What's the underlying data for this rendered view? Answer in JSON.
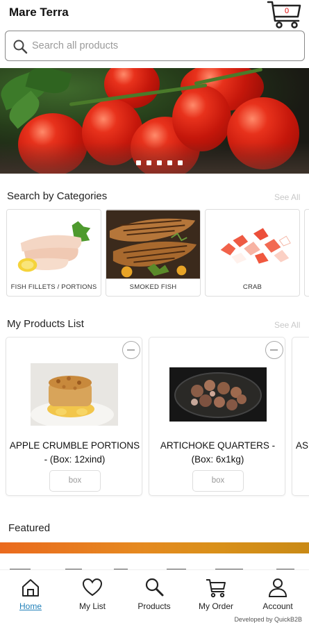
{
  "header": {
    "title": "Mare Terra",
    "cart_count": "0"
  },
  "search": {
    "placeholder": "Search all products"
  },
  "banner": {
    "slides": 5
  },
  "categories": {
    "title": "Search by Categories",
    "see_all": "See All",
    "items": [
      {
        "label": "FISH FILLETS / PORTIONS"
      },
      {
        "label": "SMOKED FISH"
      },
      {
        "label": "CRAB"
      }
    ]
  },
  "products": {
    "title": "My Products List",
    "see_all": "See All",
    "items": [
      {
        "name": "APPLE CRUMBLE PORTIONS - (Box: 12xind)",
        "unit": "box"
      },
      {
        "name": "ARTICHOKE QUARTERS - (Box: 6x1kg)",
        "unit": "box"
      },
      {
        "name": "AS"
      }
    ]
  },
  "featured": {
    "title": "Featured"
  },
  "nav": {
    "items": [
      {
        "label": "Home"
      },
      {
        "label": "My List"
      },
      {
        "label": "Products"
      },
      {
        "label": "My Order"
      },
      {
        "label": "Account"
      }
    ]
  },
  "footer": {
    "credit": "Developed by QuickB2B"
  },
  "colors": {
    "accent": "#1f7fb8",
    "banner_stripe": "#e58920",
    "badge": "#e00000"
  }
}
